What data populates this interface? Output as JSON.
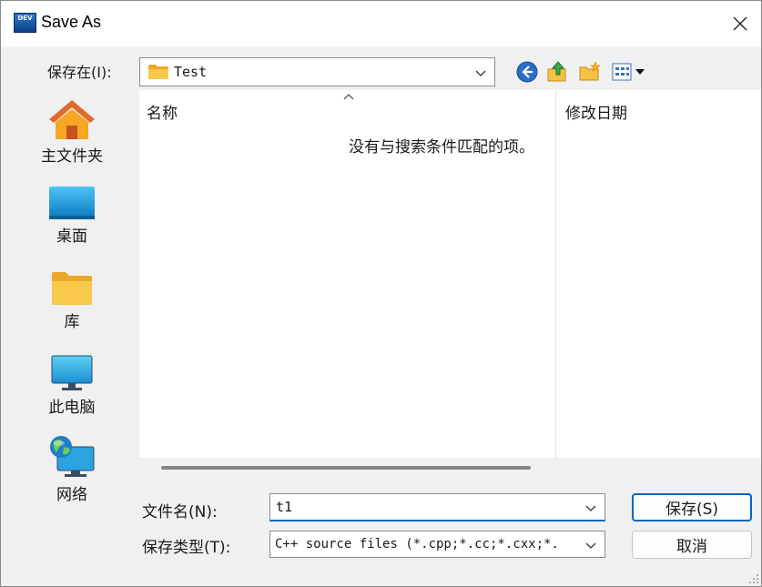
{
  "window": {
    "title": "Save As",
    "app_icon_text": "DEV"
  },
  "lookin": {
    "label": "保存在(I):",
    "value": "Test"
  },
  "places": [
    {
      "id": "home",
      "label": "主文件夹"
    },
    {
      "id": "desktop",
      "label": "桌面"
    },
    {
      "id": "library",
      "label": "库"
    },
    {
      "id": "computer",
      "label": "此电脑"
    },
    {
      "id": "network",
      "label": "网络"
    }
  ],
  "filelist": {
    "columns": [
      "名称",
      "修改日期"
    ],
    "empty_message": "没有与搜索条件匹配的项。"
  },
  "filename": {
    "label": "文件名(N):",
    "value": "t1"
  },
  "filetype": {
    "label": "保存类型(T):",
    "value": "C++ source files (*.cpp;*.cc;*.cxx;*."
  },
  "buttons": {
    "save": "保存(S)",
    "cancel": "取消"
  },
  "colors": {
    "accent": "#0067c0",
    "folder": "#f8c94b"
  }
}
